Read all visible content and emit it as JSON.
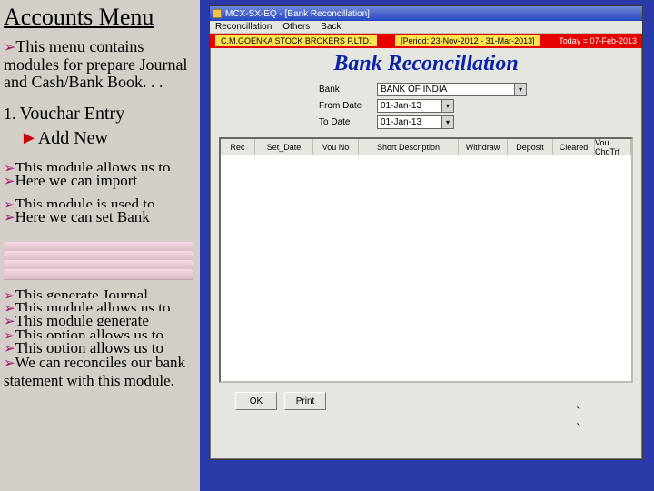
{
  "left": {
    "title": "Accounts Menu",
    "intro_prefix": "This menu contains modules for prepare Journal and Cash/Bank Book. . .",
    "list_num": "1.",
    "vouchar": "Vouchar Entry",
    "addnew": "Add New",
    "lines": {
      "a": "This module allows us to",
      "b": "Here we can import",
      "c": "This module is used to",
      "d": "Here we can set Bank",
      "e": "This generate Journal",
      "f": "This module allows us to",
      "g": "This module generate",
      "h": "This option allows us to",
      "i": "This option allows us to",
      "j": "We can reconciles our bank statement with this module."
    }
  },
  "app": {
    "title": "MCX-SX-EQ - [Bank Reconcillation]",
    "menu": {
      "a": "Reconcillation",
      "b": "Others",
      "c": "Back"
    },
    "company": "C.M.GOENKA STOCK BROKERS P.LTD.",
    "period": "[Period: 23-Nov-2012 - 31-Mar-2013]",
    "today": "Today = 07-Feb-2013",
    "bigtitle": "Bank Reconcillation",
    "form": {
      "bank_label": "Bank",
      "bank_value": "BANK OF INDIA",
      "from_label": "From Date",
      "from_value": "01-Jan-13",
      "to_label": "To Date",
      "to_value": "01-Jan-13"
    },
    "grid": {
      "h1": "Rec",
      "h2": "Set_Date",
      "h3": "Vou No",
      "h4": "Short Description",
      "h5": "Withdraw",
      "h6": "Deposit",
      "h7": "Cleared",
      "h8": "Vou ChqTrf"
    },
    "buttons": {
      "ok": "OK",
      "print": "Print"
    }
  }
}
